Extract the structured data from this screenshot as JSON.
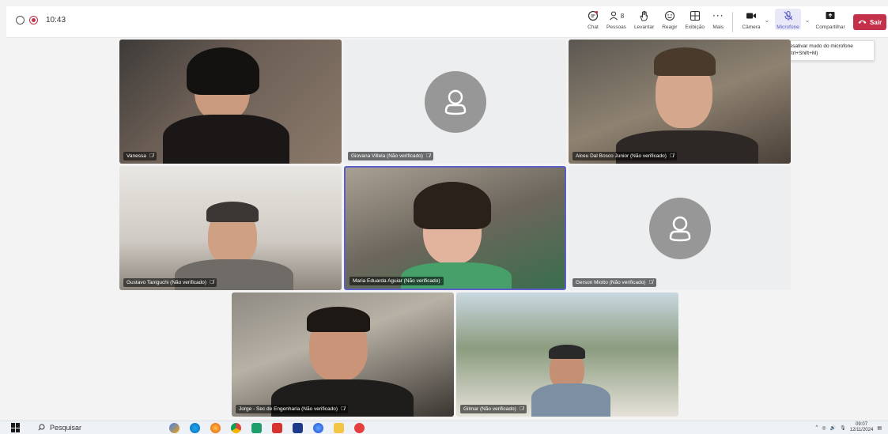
{
  "meeting": {
    "elapsed": "10:43"
  },
  "toolbar": {
    "chat": "Chat",
    "people": "Pessoas",
    "people_count": "8",
    "raise": "Levantar",
    "react": "Reagir",
    "view": "Exibição",
    "more": "Mais",
    "camera": "Câmera",
    "microphone": "Microfone",
    "share": "Compartilhar",
    "leave": "Sair"
  },
  "tooltip": {
    "line1": "Desativar mudo do microfone",
    "line2": "(Ctrl+Shift+M)"
  },
  "participants": [
    {
      "name": "Vanessa"
    },
    {
      "name": "Giovana Villela (Não verificado)"
    },
    {
      "name": "Alceu Dal Bosco Junior (Não verificado)"
    },
    {
      "name": "Gustavo Taniguchi (Não verificado)"
    },
    {
      "name": "Maria Eduarda Aguiar (Não verificado)"
    },
    {
      "name": "Gerson Miotto (Não verificado)"
    },
    {
      "name": "Jorge - Sec de Engenharia (Não verificado)"
    },
    {
      "name": "Gilmar (Não verificado)"
    }
  ],
  "taskbar": {
    "search_label": "Pesquisar",
    "time": "09:07",
    "date": "12/11/2024"
  },
  "colors": {
    "accent": "#5b5fc7",
    "leave": "#c4314b"
  }
}
